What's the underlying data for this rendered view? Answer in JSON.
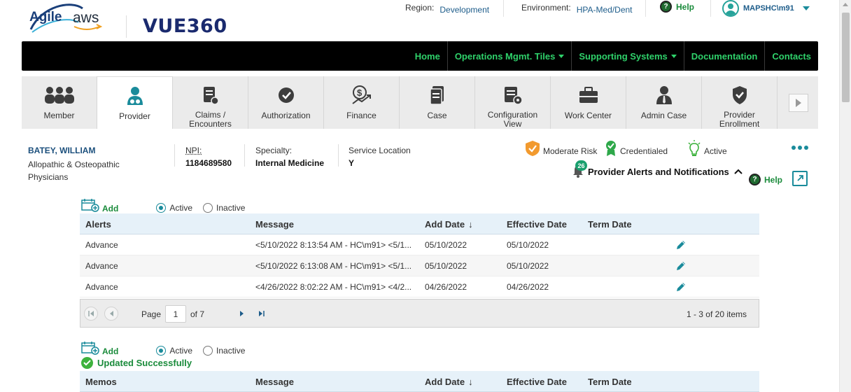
{
  "header": {
    "logo_agile_text": "Agile",
    "logo_aws_text": "aws",
    "logo_product": "VUE360",
    "region_label": "Region:",
    "region_value": "Development",
    "environment_label": "Environment:",
    "environment_value": "HPA-Med/Dent",
    "help_label": "Help",
    "user_name": "MAPSHC\\m91"
  },
  "nav": {
    "items": [
      "Home",
      "Operations Mgmt. Tiles",
      "Supporting Systems",
      "Documentation",
      "Contacts"
    ]
  },
  "tiles": [
    {
      "label": "Member",
      "icon": "members-icon"
    },
    {
      "label": "Provider",
      "icon": "provider-icon",
      "active": true
    },
    {
      "label": "Claims / Encounters",
      "icon": "claims-icon"
    },
    {
      "label": "Authorization",
      "icon": "authorization-icon"
    },
    {
      "label": "Finance",
      "icon": "finance-icon"
    },
    {
      "label": "Case",
      "icon": "case-icon"
    },
    {
      "label": "Configuration View",
      "icon": "configuration-icon"
    },
    {
      "label": "Work Center",
      "icon": "briefcase-icon"
    },
    {
      "label": "Admin Case",
      "icon": "admin-icon"
    },
    {
      "label": "Provider Enrollment",
      "icon": "shield-check-icon"
    }
  ],
  "provider": {
    "name": "BATEY, WILLIAM",
    "type": "Allopathic & Osteopathic Physicians",
    "npi_label": "NPI:",
    "npi_value": "1184689580",
    "specialty_label": "Specialty:",
    "specialty_value": "Internal Medicine",
    "service_location_label": "Service Location",
    "service_location_value": "Y",
    "risk": "Moderate Risk",
    "credential": "Credentialed",
    "status": "Active",
    "alerts_link": "Provider Alerts and Notifications",
    "alerts_count": "26",
    "help_label": "Help"
  },
  "alerts_section": {
    "add_label": "Add",
    "active_label": "Active",
    "inactive_label": "Inactive",
    "active_selected": true,
    "columns": [
      "Alerts",
      "Message",
      "Add Date",
      "Effective Date",
      "Term Date"
    ],
    "rows": [
      {
        "alert": "Advance",
        "message": "<5/10/2022 8:13:54 AM - HC\\m91> <5/1...",
        "add_date": "05/10/2022",
        "effective_date": "05/10/2022",
        "term_date": ""
      },
      {
        "alert": "Advance",
        "message": "<5/10/2022 6:13:08 AM - HC\\m91> <5/1...",
        "add_date": "05/10/2022",
        "effective_date": "05/10/2022",
        "term_date": ""
      },
      {
        "alert": "Advance",
        "message": "<4/26/2022 8:02:22 AM - HC\\m91> <4/2...",
        "add_date": "04/26/2022",
        "effective_date": "04/26/2022",
        "term_date": ""
      }
    ],
    "pager": {
      "page_label": "Page",
      "page_value": "1",
      "of_label": "of 7",
      "items_summary": "1 - 3 of 20 items"
    }
  },
  "memos_section": {
    "add_label": "Add",
    "active_label": "Active",
    "inactive_label": "Inactive",
    "success_message": "Updated Successfully",
    "columns": [
      "Memos",
      "Message",
      "Add Date",
      "Effective Date",
      "Term Date"
    ]
  },
  "colors": {
    "nav_text": "#2fd26b",
    "accent_teal": "#1a8b9b",
    "provider_name": "#1b4f7c",
    "success_green": "#1a8b3b",
    "grid_header_bg": "#e6f1f9"
  }
}
